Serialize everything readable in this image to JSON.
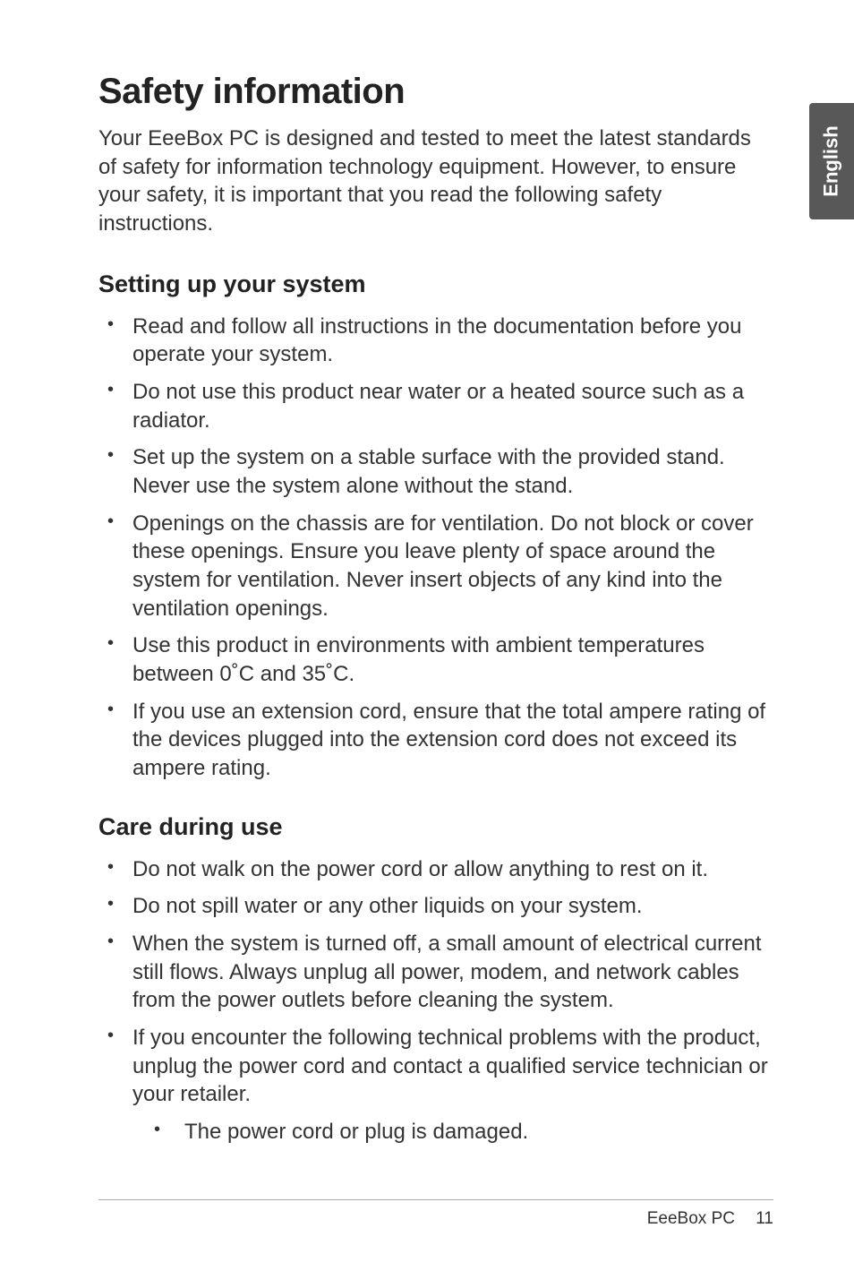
{
  "sideTab": {
    "label": "English"
  },
  "heading": "Safety information",
  "intro": "Your EeeBox PC is designed and tested to meet the latest standards of safety for information technology equipment. However, to ensure your safety, it is important that you read the following safety instructions.",
  "section1": {
    "title": "Setting up your system",
    "items": [
      "Read and follow all instructions in the documentation before you operate your system.",
      "Do not use this product near water or a heated source such as a radiator.",
      "Set up the system on a stable surface with the provided stand. Never use the system alone without the stand.",
      "Openings on the chassis are for ventilation. Do not block or cover these openings. Ensure you leave plenty of space around the system for ventilation. Never insert objects of any kind into the ventilation openings.",
      "Use this product in environments with ambient temperatures between 0˚C and 35˚C.",
      "If you use an extension cord, ensure that the total ampere rating of the devices plugged into the extension cord does not exceed its ampere rating."
    ]
  },
  "section2": {
    "title": "Care during use",
    "items": [
      "Do not walk on the power cord or allow anything to rest on it.",
      "Do not spill water or any other liquids on your system.",
      "When the system is turned off, a small amount of electrical current still flows. Always unplug all power, modem, and network cables from the power outlets before cleaning the system.",
      "If you encounter the following technical problems with the product, unplug the power cord and contact a qualified service technician or your retailer."
    ],
    "subitems": [
      "The power cord or plug is damaged."
    ]
  },
  "footer": {
    "product": "EeeBox PC",
    "page": "11"
  }
}
